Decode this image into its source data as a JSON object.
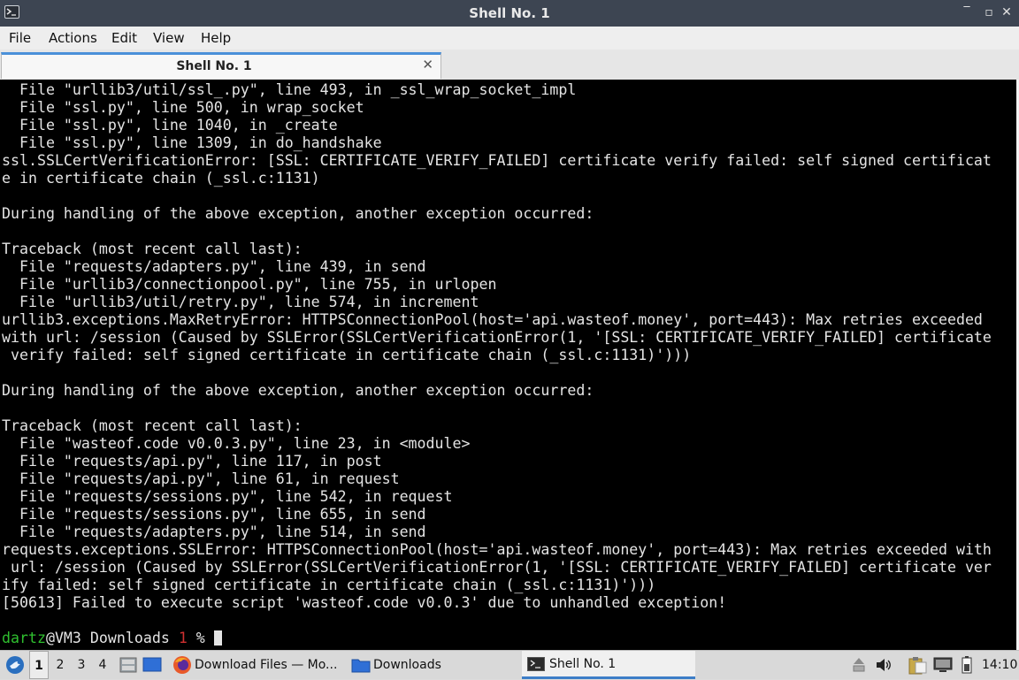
{
  "window": {
    "title": "Shell No. 1",
    "controls": [
      "‾",
      "▫",
      "✕"
    ]
  },
  "menu": [
    "File",
    "Actions",
    "Edit",
    "View",
    "Help"
  ],
  "tab": {
    "label": "Shell No. 1",
    "close": "✕"
  },
  "terminal": {
    "lines": [
      "  File \"urllib3/util/ssl_.py\", line 493, in _ssl_wrap_socket_impl",
      "  File \"ssl.py\", line 500, in wrap_socket",
      "  File \"ssl.py\", line 1040, in _create",
      "  File \"ssl.py\", line 1309, in do_handshake",
      "ssl.SSLCertVerificationError: [SSL: CERTIFICATE_VERIFY_FAILED] certificate verify failed: self signed certificat",
      "e in certificate chain (_ssl.c:1131)",
      "",
      "During handling of the above exception, another exception occurred:",
      "",
      "Traceback (most recent call last):",
      "  File \"requests/adapters.py\", line 439, in send",
      "  File \"urllib3/connectionpool.py\", line 755, in urlopen",
      "  File \"urllib3/util/retry.py\", line 574, in increment",
      "urllib3.exceptions.MaxRetryError: HTTPSConnectionPool(host='api.wasteof.money', port=443): Max retries exceeded",
      "with url: /session (Caused by SSLError(SSLCertVerificationError(1, '[SSL: CERTIFICATE_VERIFY_FAILED] certificate",
      " verify failed: self signed certificate in certificate chain (_ssl.c:1131)')))",
      "",
      "During handling of the above exception, another exception occurred:",
      "",
      "Traceback (most recent call last):",
      "  File \"wasteof.code v0.0.3.py\", line 23, in <module>",
      "  File \"requests/api.py\", line 117, in post",
      "  File \"requests/api.py\", line 61, in request",
      "  File \"requests/sessions.py\", line 542, in request",
      "  File \"requests/sessions.py\", line 655, in send",
      "  File \"requests/adapters.py\", line 514, in send",
      "requests.exceptions.SSLError: HTTPSConnectionPool(host='api.wasteof.money', port=443): Max retries exceeded with",
      " url: /session (Caused by SSLError(SSLCertVerificationError(1, '[SSL: CERTIFICATE_VERIFY_FAILED] certificate ver",
      "ify failed: self signed certificate in certificate chain (_ssl.c:1131)')))",
      "[50613] Failed to execute script 'wasteof.code v0.0.3' due to unhandled exception!",
      ""
    ],
    "prompt": {
      "user": "dartz",
      "host_path": "@VM3 Downloads ",
      "exit_code": "1",
      "symbol": " % "
    }
  },
  "taskbar": {
    "workspaces": [
      "1",
      "2",
      "3",
      "4"
    ],
    "active_workspace": "1",
    "tasks": [
      {
        "label": "Download Files — Mo...",
        "icon": "firefox-icon"
      },
      {
        "label": "Downloads",
        "icon": "folder-icon"
      },
      {
        "label": "Shell No. 1",
        "icon": "terminal-icon"
      }
    ],
    "clock": "14:10"
  }
}
